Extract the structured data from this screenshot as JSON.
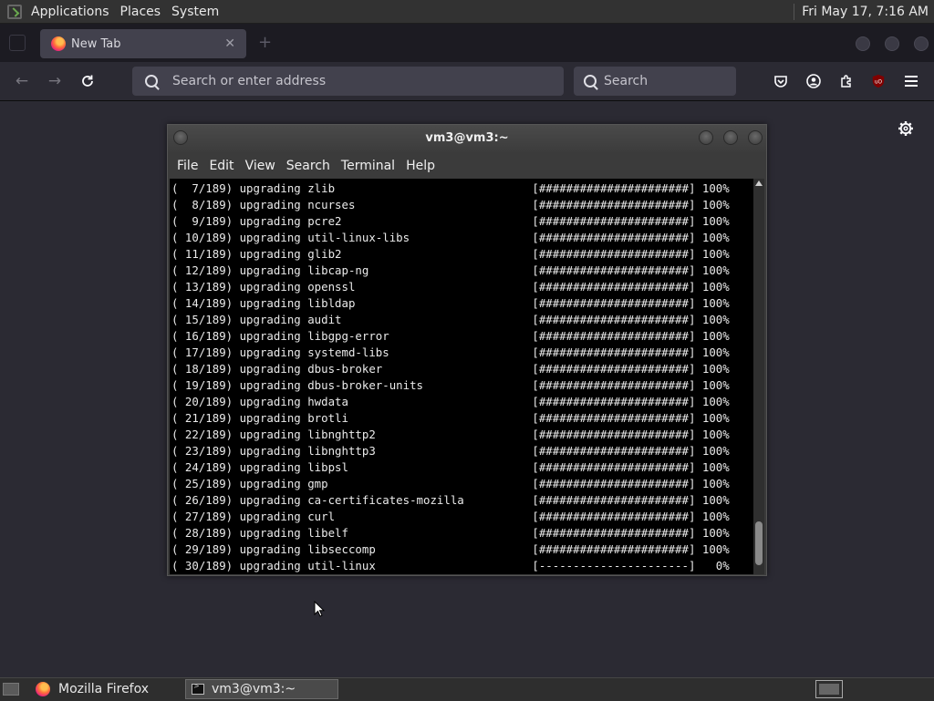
{
  "top_panel": {
    "menus": [
      "Applications",
      "Places",
      "System"
    ],
    "clock": "Fri May 17,  7:16 AM"
  },
  "browser": {
    "tab_title": "New Tab",
    "url_placeholder": "Search or enter address",
    "search_placeholder": "Search",
    "extension_badge": "uO"
  },
  "terminal": {
    "title": "vm3@vm3:~",
    "menu": [
      "File",
      "Edit",
      "View",
      "Search",
      "Terminal",
      "Help"
    ],
    "lines": [
      "(  7/189) upgrading zlib                             [######################] 100%",
      "(  8/189) upgrading ncurses                          [######################] 100%",
      "(  9/189) upgrading pcre2                            [######################] 100%",
      "( 10/189) upgrading util-linux-libs                  [######################] 100%",
      "( 11/189) upgrading glib2                            [######################] 100%",
      "( 12/189) upgrading libcap-ng                        [######################] 100%",
      "( 13/189) upgrading openssl                          [######################] 100%",
      "( 14/189) upgrading libldap                          [######################] 100%",
      "( 15/189) upgrading audit                            [######################] 100%",
      "( 16/189) upgrading libgpg-error                     [######################] 100%",
      "( 17/189) upgrading systemd-libs                     [######################] 100%",
      "( 18/189) upgrading dbus-broker                      [######################] 100%",
      "( 19/189) upgrading dbus-broker-units                [######################] 100%",
      "( 20/189) upgrading hwdata                           [######################] 100%",
      "( 21/189) upgrading brotli                           [######################] 100%",
      "( 22/189) upgrading libnghttp2                       [######################] 100%",
      "( 23/189) upgrading libnghttp3                       [######################] 100%",
      "( 24/189) upgrading libpsl                           [######################] 100%",
      "( 25/189) upgrading gmp                              [######################] 100%",
      "( 26/189) upgrading ca-certificates-mozilla          [######################] 100%",
      "( 27/189) upgrading curl                             [######################] 100%",
      "( 28/189) upgrading libelf                           [######################] 100%",
      "( 29/189) upgrading libseccomp                       [######################] 100%",
      "( 30/189) upgrading util-linux                       [----------------------]   0%"
    ]
  },
  "taskbar": {
    "items": [
      "Mozilla Firefox",
      "vm3@vm3:~"
    ]
  }
}
